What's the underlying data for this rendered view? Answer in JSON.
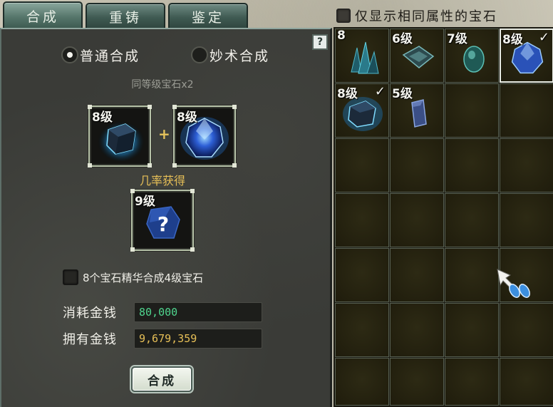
{
  "tabs": [
    {
      "label": "合成",
      "active": true
    },
    {
      "label": "重铸",
      "active": false
    },
    {
      "label": "鉴定",
      "active": false
    }
  ],
  "filter": {
    "label": "仅显示相同属性的宝石",
    "checked": false
  },
  "help": {
    "label": "?"
  },
  "modes": [
    {
      "label": "普通合成",
      "selected": true
    },
    {
      "label": "妙术合成",
      "selected": false
    }
  ],
  "requirement_text": "同等级宝石x2",
  "input_slots": [
    {
      "level": "8级",
      "gem": "dark-blue-cube-gem-icon"
    },
    {
      "level": "8级",
      "gem": "blue-round-gem-icon"
    }
  ],
  "plus": "+",
  "result_label": "几率获得",
  "result_slot": {
    "level": "9级",
    "mark": "?",
    "gem": "unknown-gem-icon"
  },
  "essence_option": {
    "label": "8个宝石精华合成4级宝石",
    "checked": false
  },
  "cost": {
    "label": "消耗金钱",
    "value": "80,000"
  },
  "owned": {
    "label": "拥有金钱",
    "value": "9,679,359"
  },
  "combine_button": {
    "label": "合成"
  },
  "inventory": {
    "columns": 4,
    "rows": 7,
    "items": [
      {
        "level": "8",
        "checked": false,
        "gem": "teal-crystal-cluster-icon"
      },
      {
        "level": "6级",
        "checked": false,
        "gem": "teal-rectangular-gem-icon"
      },
      {
        "level": "7级",
        "checked": false,
        "gem": "teal-oval-gem-icon"
      },
      {
        "level": "8级",
        "checked": true,
        "selected": true,
        "gem": "blue-round-gem-icon"
      },
      {
        "level": "8级",
        "checked": true,
        "gem": "dark-blue-cube-gem-icon"
      },
      {
        "level": "5级",
        "checked": false,
        "gem": "blue-prism-gem-icon"
      }
    ]
  }
}
